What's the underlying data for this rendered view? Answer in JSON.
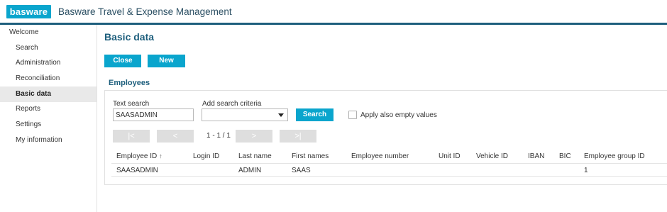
{
  "header": {
    "logo_text": "basware",
    "app_title": "Basware Travel & Expense Management"
  },
  "sidebar": {
    "items": [
      {
        "label": "Welcome"
      },
      {
        "label": "Search"
      },
      {
        "label": "Administration"
      },
      {
        "label": "Reconciliation"
      },
      {
        "label": "Basic data"
      },
      {
        "label": "Reports"
      },
      {
        "label": "Settings"
      },
      {
        "label": "My information"
      }
    ]
  },
  "main": {
    "title": "Basic data",
    "buttons": {
      "close": "Close",
      "new": "New"
    },
    "section_title": "Employees",
    "search": {
      "text_search_label": "Text search",
      "text_search_value": "SAASADMIN",
      "criteria_label": "Add search criteria",
      "criteria_value": "",
      "search_button": "Search",
      "empty_values_label": "Apply also empty values",
      "empty_values_checked": false
    },
    "pager": {
      "first": "|<",
      "prev": "<",
      "info": "1 - 1 / 1",
      "next": ">",
      "last": ">|"
    },
    "table": {
      "columns": [
        "Employee ID",
        "Login ID",
        "Last name",
        "First names",
        "Employee number",
        "Unit ID",
        "Vehicle ID",
        "IBAN",
        "BIC",
        "Employee group ID"
      ],
      "sort_indicator": "↑",
      "rows": [
        [
          "SAASADMIN",
          "",
          "ADMIN",
          "SAAS",
          "",
          "",
          "",
          "",
          "",
          "1"
        ]
      ]
    }
  },
  "colors": {
    "accent": "#0aa5cd",
    "brand_dark": "#1e5f7d",
    "active_item_bg": "#e9e9e9"
  }
}
